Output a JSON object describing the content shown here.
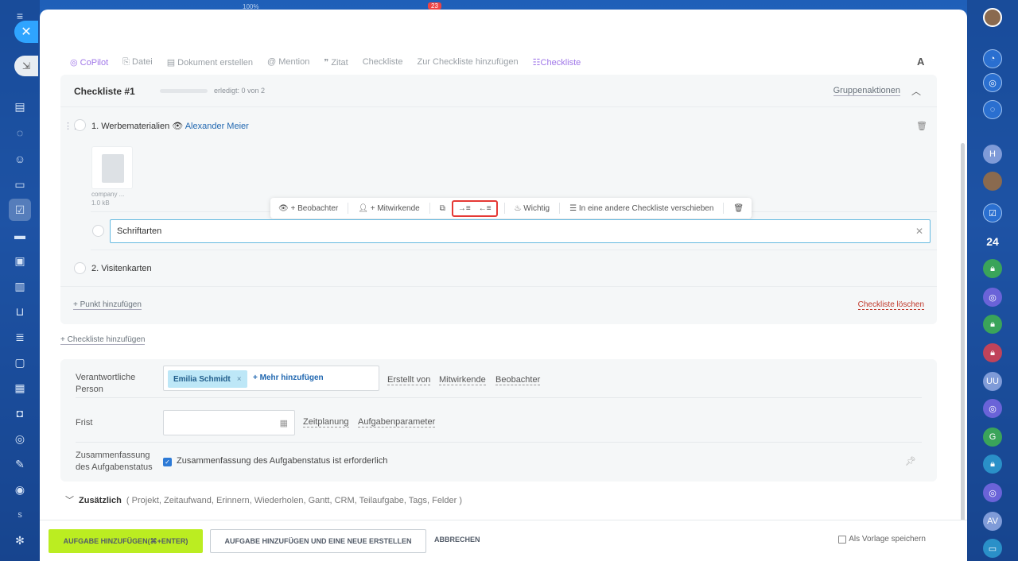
{
  "app": {
    "progress_pct": "100%",
    "notif_count": "23"
  },
  "left_nav": {
    "close_icon": "close-icon",
    "collapse_icon": "collapse-icon",
    "icons": [
      "menu-icon",
      "home-icon",
      "feed-icon",
      "chat-icon",
      "group-icon",
      "docs-icon",
      "tasks-icon",
      "crm-icon",
      "sites-icon",
      "analytics-icon",
      "shop-icon",
      "filter-icon",
      "inbox-icon",
      "calendar-icon",
      "bot-icon",
      "goals-icon",
      "edit-icon",
      "copilot-icon",
      "user-icon",
      "settings-icon"
    ],
    "user_initial": "S"
  },
  "right_nav": {
    "items": [
      "avatar",
      "bell-icon",
      "copilot-icon",
      "chat-icon",
      "H",
      "avatar",
      "tasks-icon",
      "24",
      "lock-icon",
      "copilot-icon",
      "lock-icon",
      "lock-icon",
      "UU",
      "copilot-icon",
      "G",
      "lock-icon",
      "copilot-icon",
      "AV",
      "chat-icon"
    ]
  },
  "toolbar": {
    "copilot": "CoPilot",
    "file": "Datei",
    "create_doc": "Dokument erstellen",
    "mention": "Mention",
    "quote": "Zitat",
    "checklist": "Checkliste",
    "add_to_checklist": "Zur Checkliste hinzufügen",
    "checklist_active": "Checkliste",
    "font": "A"
  },
  "checklist": {
    "title": "Checkliste #1",
    "progress": 0,
    "done_text": "erledigt: 0 von 2",
    "group_actions": "Gruppenaktionen",
    "item1": {
      "text": "1. Werbematerialien",
      "person": "Alexander Meier",
      "file_name": "company ...",
      "file_size": "1.0 kB"
    },
    "subitem_value": "Schriftarten",
    "item2": {
      "text": "2. Visitenkarten"
    },
    "add_point": "+ Punkt hinzufügen",
    "delete": "Checkliste löschen"
  },
  "float_toolbar": {
    "observer": "+ Beobachter",
    "participant": "+ Mitwirkende",
    "important": "Wichtig",
    "move": "In eine andere Checkliste verschieben"
  },
  "add_checklist": "+ Checkliste hinzufügen",
  "form": {
    "responsible_label_1": "Verantwortliche",
    "responsible_label_2": "Person",
    "responsible_chip": "Emilia Schmidt",
    "add_more": "+ Mehr hinzufügen",
    "created_by": "Erstellt von",
    "participants": "Mitwirkende",
    "observers": "Beobachter",
    "deadline_label": "Frist",
    "deadline_value": "",
    "planning": "Zeitplanung",
    "task_params": "Aufgabenparameter",
    "summary_label_1": "Zusammenfassung",
    "summary_label_2": "des Aufgabenstatus",
    "summary_checkbox": "Zusammenfassung des Aufgabenstatus ist erforderlich",
    "summary_checked": true
  },
  "extra": {
    "title": "Zusätzlich",
    "items": "( Projekt,  Zeitaufwand,  Erinnern,  Wiederholen,  Gantt,  CRM,  Teilaufgabe,  Tags,  Felder )"
  },
  "footer": {
    "primary": "AUFGABE HINZUFÜGEN(⌘+ENTER)",
    "secondary": "AUFGABE HINZUFÜGEN UND EINE NEUE ERSTELLEN",
    "cancel": "ABBRECHEN",
    "template": "Als Vorlage speichern"
  },
  "colors": {
    "accent": "#2067b0",
    "primary_btn": "#bbed21",
    "highlight": "#e53935",
    "copilot": "#a077e8"
  }
}
